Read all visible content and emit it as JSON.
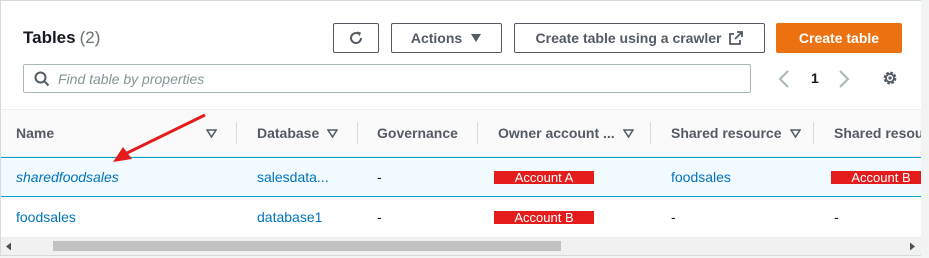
{
  "header": {
    "title": "Tables",
    "count": "(2)"
  },
  "toolbar": {
    "actions_label": "Actions",
    "crawler_label": "Create table using a crawler",
    "create_label": "Create table"
  },
  "search": {
    "placeholder": "Find table by properties",
    "value": ""
  },
  "pagination": {
    "current_page": "1"
  },
  "columns": [
    {
      "label": "Name"
    },
    {
      "label": "Database"
    },
    {
      "label": "Governance"
    },
    {
      "label": "Owner account ..."
    },
    {
      "label": "Shared resource"
    },
    {
      "label": "Shared resou"
    }
  ],
  "rows": [
    {
      "name": "sharedfoodsales",
      "database": "salesdata...",
      "governance": "-",
      "owner_account": "Account A",
      "shared_resource": "foodsales",
      "shared_resource_owner": "Account B"
    },
    {
      "name": "foodsales",
      "database": "database1",
      "governance": "-",
      "owner_account": "Account B",
      "shared_resource": "-",
      "shared_resource_owner": "-"
    }
  ],
  "colors": {
    "primary": "#ec7211",
    "link": "#0073bb",
    "annotation_red": "#e41c1c",
    "selected_border": "#00a1c9"
  },
  "icons": {
    "refresh": "refresh-icon",
    "dropdown": "caret-down-icon",
    "external": "external-link-icon",
    "search": "search-icon",
    "settings": "gear-icon",
    "sort": "sort-caret-icon"
  }
}
